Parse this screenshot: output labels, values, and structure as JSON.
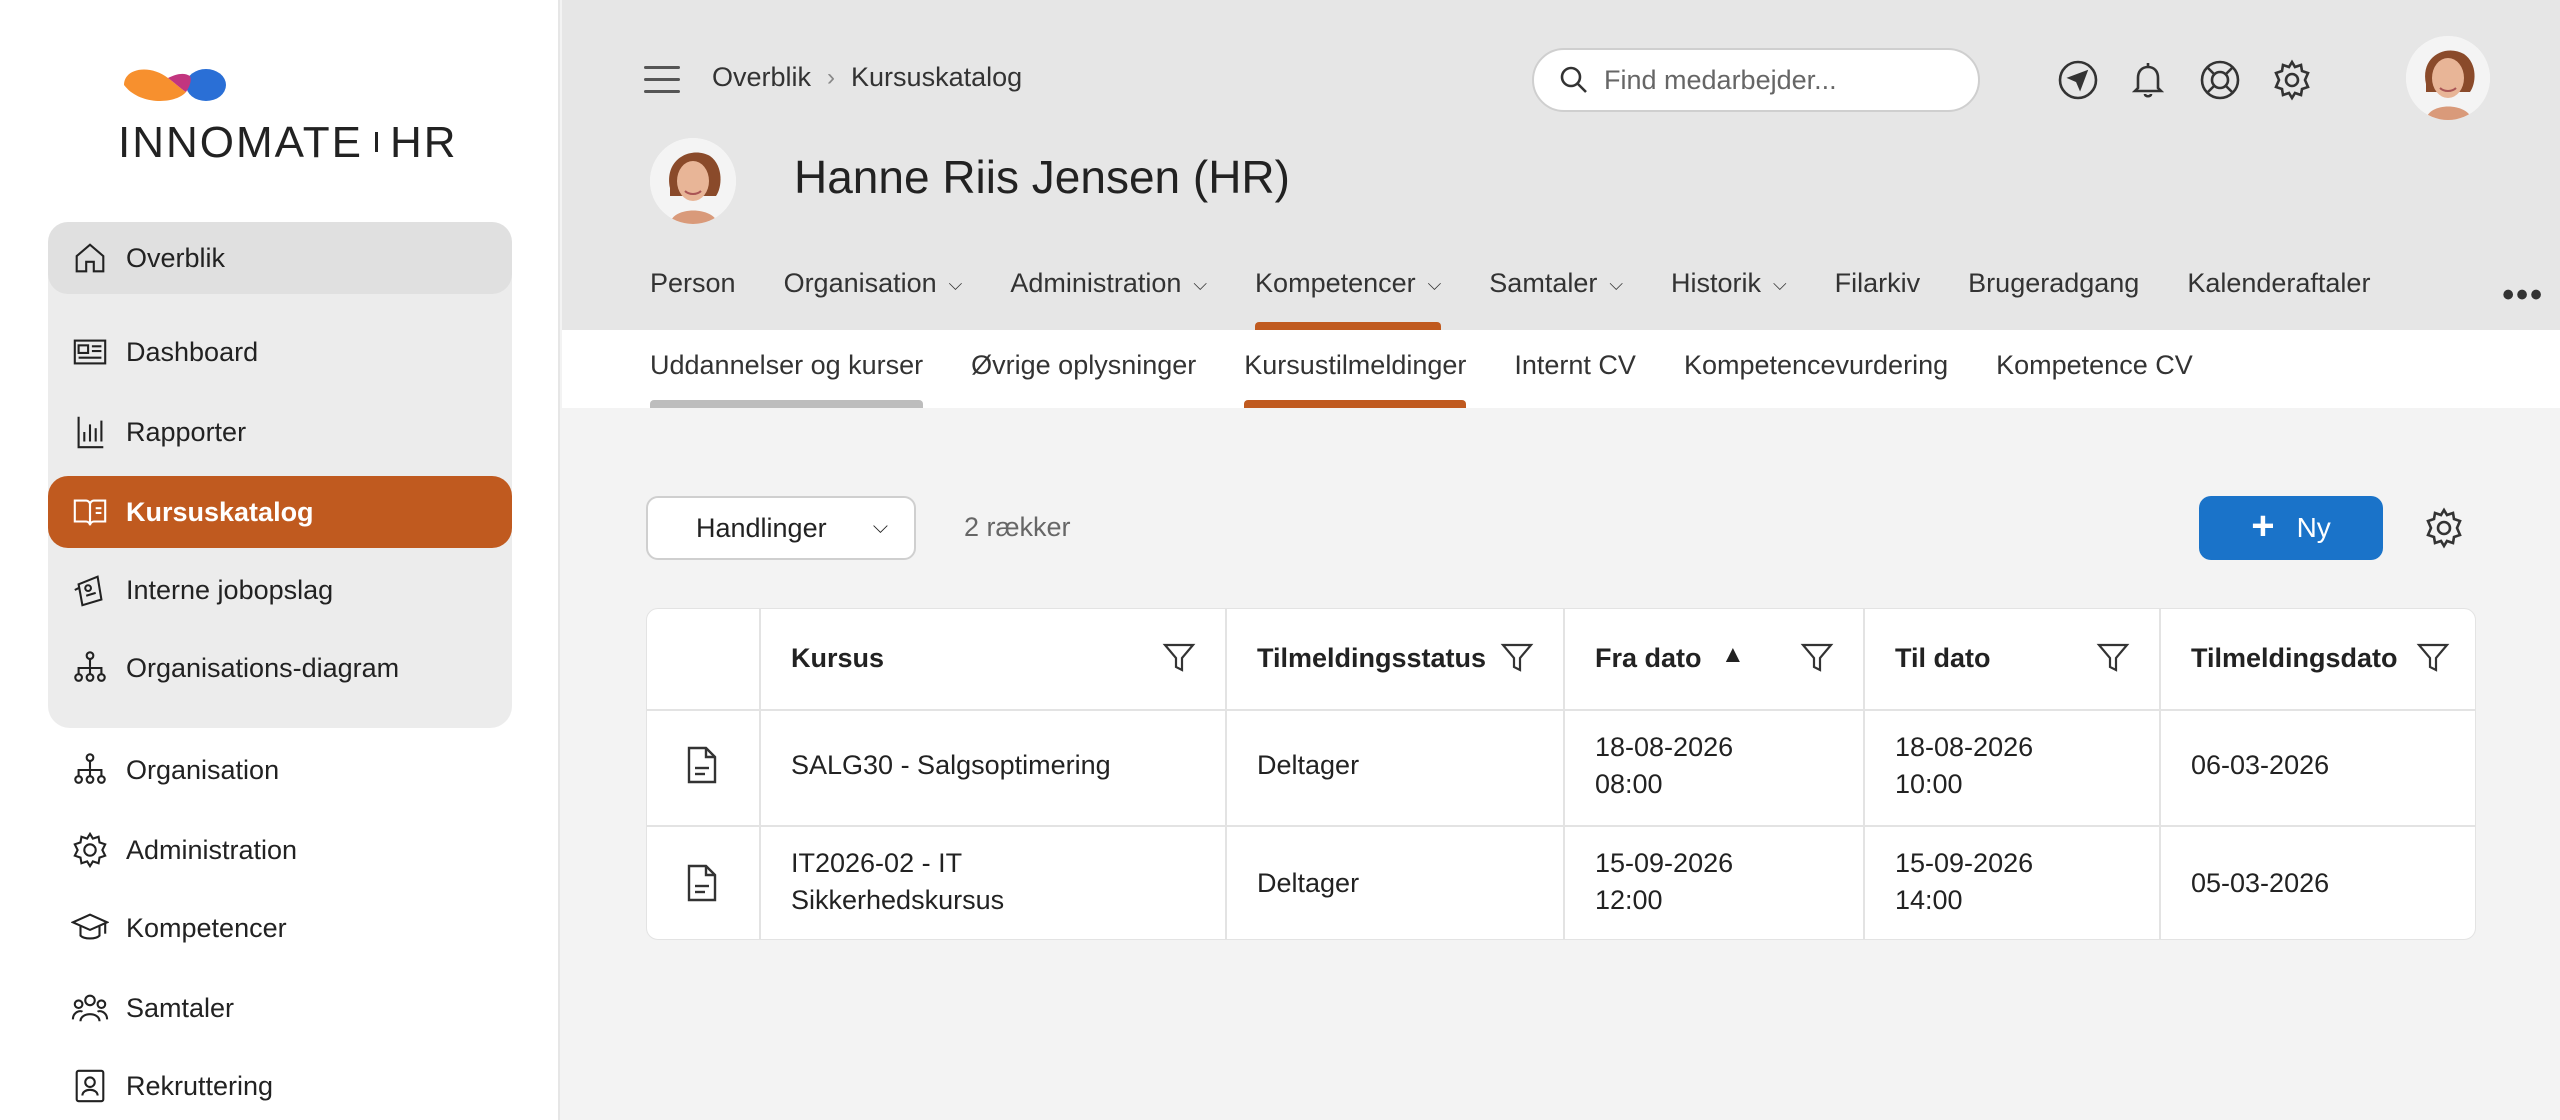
{
  "brand": {
    "logo_left": "INNO",
    "logo_mid": "MATE",
    "logo_right": "HR",
    "colors": {
      "accent": "#c05a1f",
      "primary": "#1a73c9",
      "logo_orange": "#f7902e",
      "logo_blue": "#2a6fd6"
    }
  },
  "sidebar": {
    "items": [
      {
        "label": "Overblik",
        "icon": "home-icon"
      },
      {
        "label": "Dashboard",
        "icon": "dashboard-icon"
      },
      {
        "label": "Rapporter",
        "icon": "report-icon"
      },
      {
        "label": "Kursuskatalog",
        "icon": "book-icon"
      },
      {
        "label": "Interne jobopslag",
        "icon": "job-post-icon"
      },
      {
        "label": "Organisations-diagram",
        "icon": "org-chart-icon"
      },
      {
        "label": "Organisation",
        "icon": "org-chart-icon"
      },
      {
        "label": "Administration",
        "icon": "gear-icon"
      },
      {
        "label": "Kompetencer",
        "icon": "graduation-cap-icon"
      },
      {
        "label": "Samtaler",
        "icon": "people-icon"
      },
      {
        "label": "Rekruttering",
        "icon": "recruitment-icon"
      }
    ]
  },
  "header": {
    "breadcrumb": [
      "Overblik",
      "Kursuskatalog"
    ],
    "search_placeholder": "Find medarbejder...",
    "person_name": "Hanne Riis Jensen (HR)",
    "tabs": [
      "Person",
      "Organisation",
      "Administration",
      "Kompetencer",
      "Samtaler",
      "Historik",
      "Filarkiv",
      "Brugeradgang",
      "Kalenderaftaler"
    ],
    "more": "•••",
    "subtabs": [
      "Uddannelser og kurser",
      "Øvrige oplysninger",
      "Kursustilmeldinger",
      "Internt CV",
      "Kompetencevurdering",
      "Kompetence CV"
    ]
  },
  "toolbar": {
    "actions_label": "Handlinger",
    "row_count": "2 rækker",
    "new_label": "Ny"
  },
  "table": {
    "columns": [
      "Kursus",
      "Tilmeldingsstatus",
      "Fra dato",
      "Til dato",
      "Tilmeldingsdato"
    ],
    "rows": [
      {
        "course": [
          "SALG30 - Salgsoptimering",
          ""
        ],
        "status": "Deltager",
        "from": [
          "18-08-2026",
          "08:00"
        ],
        "to": [
          "18-08-2026",
          "10:00"
        ],
        "registered": "06-03-2026"
      },
      {
        "course": [
          "IT2026-02 - IT",
          "Sikkerhedskursus"
        ],
        "status": "Deltager",
        "from": [
          "15-09-2026",
          "12:00"
        ],
        "to": [
          "15-09-2026",
          "14:00"
        ],
        "registered": "05-03-2026"
      }
    ]
  }
}
